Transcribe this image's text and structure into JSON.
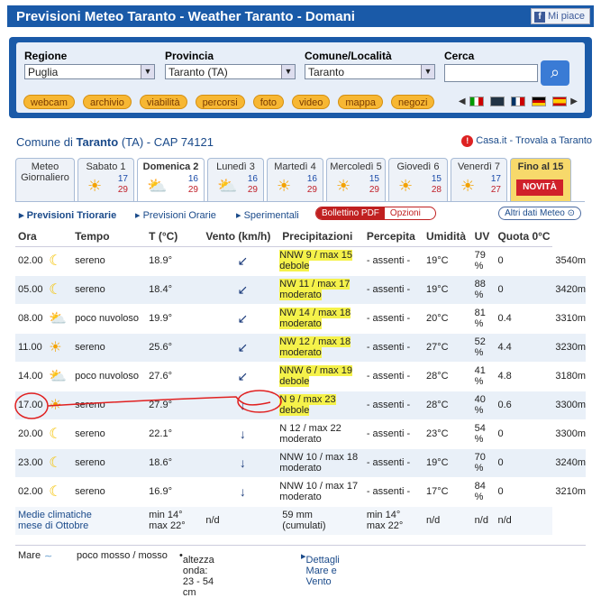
{
  "header": {
    "title": "Previsioni Meteo Taranto - Weather Taranto - Domani",
    "fb_label": "Mi piace"
  },
  "search": {
    "regione_label": "Regione",
    "regione_value": "Puglia",
    "provincia_label": "Provincia",
    "provincia_value": "Taranto (TA)",
    "comune_label": "Comune/Località",
    "comune_value": "Taranto",
    "cerca_label": "Cerca",
    "links": [
      "webcam",
      "archivio",
      "viabilità",
      "percorsi",
      "foto",
      "video",
      "mappa",
      "negozi"
    ]
  },
  "location": {
    "prefix": "Comune di",
    "name": "Taranto",
    "suffix": "(TA) - CAP 74121",
    "casa_link": "Casa.it - Trovala a Taranto"
  },
  "tabs": [
    {
      "label": "Meteo",
      "label2": "Giornaliero"
    },
    {
      "label": "Sabato 1",
      "min": "17",
      "max": "29",
      "icon": "sun"
    },
    {
      "label": "Domenica 2",
      "min": "16",
      "max": "29",
      "icon": "partly"
    },
    {
      "label": "Lunedì 3",
      "min": "16",
      "max": "29",
      "icon": "partly"
    },
    {
      "label": "Martedì 4",
      "min": "16",
      "max": "29",
      "icon": "sun"
    },
    {
      "label": "Mercoledì 5",
      "min": "15",
      "max": "29",
      "icon": "sun"
    },
    {
      "label": "Giovedì 6",
      "min": "15",
      "max": "28",
      "icon": "sun"
    },
    {
      "label": "Venerdì 7",
      "min": "17",
      "max": "27",
      "icon": "sun"
    },
    {
      "label": "Fino al 15",
      "badge": "NOVITÀ"
    }
  ],
  "subnav": {
    "triorarie": "Previsioni Triorarie",
    "orarie": "Previsioni Orarie",
    "sperimentali": "Sperimentali",
    "bollettino": "Bollettino PDF",
    "opzioni": "Opzioni",
    "altri": "Altri dati Meteo"
  },
  "table": {
    "headers": [
      "Ora",
      "Tempo",
      "T (°C)",
      "Vento (km/h)",
      "Precipitazioni",
      "Percepita",
      "Umidità",
      "UV",
      "Quota 0°C"
    ],
    "rows": [
      {
        "ora": "02.00",
        "icon": "moon",
        "tempo": "sereno",
        "t": "18.9°",
        "vento1": "NNW 9 / max 15",
        "vento2": "debole",
        "prec": "- assenti -",
        "perc": "19°C",
        "umid": "79 %",
        "uv": "0",
        "quota": "3540m"
      },
      {
        "ora": "05.00",
        "icon": "moon",
        "tempo": "sereno",
        "t": "18.4°",
        "vento1": "NW 11 / max 17",
        "vento2": "moderato",
        "prec": "- assenti -",
        "perc": "19°C",
        "umid": "88 %",
        "uv": "0",
        "quota": "3420m"
      },
      {
        "ora": "08.00",
        "icon": "partly",
        "tempo": "poco nuvoloso",
        "t": "19.9°",
        "vento1": "NW 14 / max 18",
        "vento2": "moderato",
        "prec": "- assenti -",
        "perc": "20°C",
        "umid": "81 %",
        "uv": "0.4",
        "quota": "3310m"
      },
      {
        "ora": "11.00",
        "icon": "sun",
        "tempo": "sereno",
        "t": "25.6°",
        "vento1": "NW 12 / max 18",
        "vento2": "moderato",
        "prec": "- assenti -",
        "perc": "27°C",
        "umid": "52 %",
        "uv": "4.4",
        "quota": "3230m"
      },
      {
        "ora": "14.00",
        "icon": "partly",
        "tempo": "poco nuvoloso",
        "t": "27.6°",
        "vento1": "NNW 6 / max 19",
        "vento2": "debole",
        "prec": "- assenti -",
        "perc": "28°C",
        "umid": "41 %",
        "uv": "4.8",
        "quota": "3180m"
      },
      {
        "ora": "17.00",
        "icon": "sun",
        "tempo": "sereno",
        "t": "27.9°",
        "vento1": "N 9 / max 23",
        "vento2": "debole",
        "prec": "- assenti -",
        "perc": "28°C",
        "umid": "40 %",
        "uv": "0.6",
        "quota": "3300m"
      },
      {
        "ora": "20.00",
        "icon": "moon",
        "tempo": "sereno",
        "t": "22.1°",
        "vento1": "N 12 / max 22",
        "vento2": "moderato",
        "prec": "- assenti -",
        "perc": "23°C",
        "umid": "54 %",
        "uv": "0",
        "quota": "3300m"
      },
      {
        "ora": "23.00",
        "icon": "moon",
        "tempo": "sereno",
        "t": "18.6°",
        "vento1": "NNW 10 / max 18",
        "vento2": "moderato",
        "prec": "- assenti -",
        "perc": "19°C",
        "umid": "70 %",
        "uv": "0",
        "quota": "3240m"
      },
      {
        "ora": "02.00",
        "icon": "moon",
        "tempo": "sereno",
        "t": "16.9°",
        "vento1": "NNW 10 / max 17",
        "vento2": "moderato",
        "prec": "- assenti -",
        "perc": "17°C",
        "umid": "84 %",
        "uv": "0",
        "quota": "3210m"
      }
    ],
    "footer": {
      "label1": "Medie climatiche",
      "label2": "mese di Ottobre",
      "tmin": "min 14°",
      "tmax": "max 22°",
      "vento": "n/d",
      "prec1": "59 mm",
      "prec2": "(cumulati)",
      "perc_min": "min 14°",
      "perc_max": "max 22°",
      "umid": "n/d",
      "uv": "n/d",
      "quota": "n/d"
    }
  },
  "mare": {
    "label": "Mare",
    "state": "poco mosso / mosso",
    "onda": "altezza onda: 23 - 54 cm",
    "link": "Dettagli Mare e Vento"
  },
  "colors": {
    "brand": "#1a5aa8",
    "highlight": "#f5f24a",
    "annotation": "#e02020"
  }
}
